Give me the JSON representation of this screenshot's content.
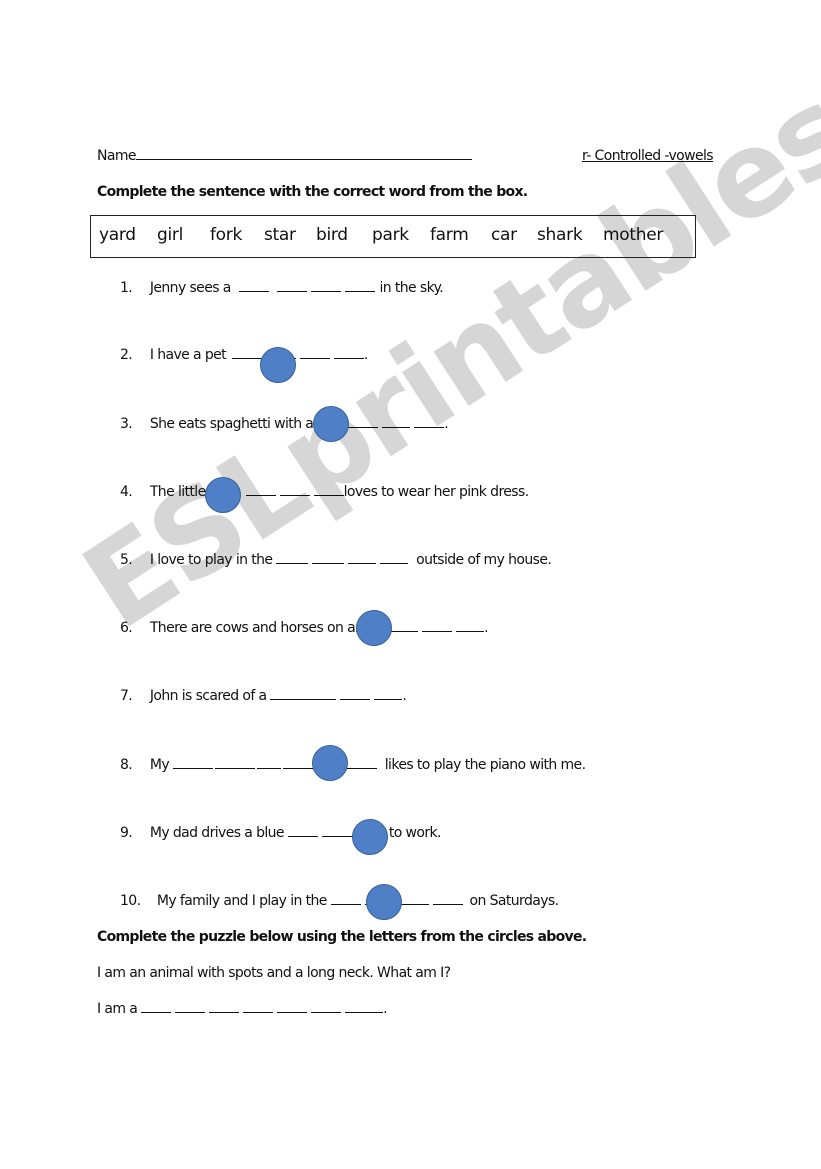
{
  "header": {
    "name_label": "Name",
    "topic": "r- Controlled -vowels"
  },
  "instructions": {
    "part1": "Complete the sentence with the correct word from the box.",
    "part2": "Complete the puzzle below using the letters from the circles above."
  },
  "word_bank": [
    "yard",
    "girl",
    "fork",
    "star",
    "bird",
    "park",
    "farm",
    "car",
    "shark",
    "mother"
  ],
  "sentences": [
    {
      "num": "1.",
      "before": "Jenny sees a",
      "after": "in the sky.",
      "has_circle": false
    },
    {
      "num": "2.",
      "before": "I have a pet",
      "after": ".",
      "has_circle": true
    },
    {
      "num": "3.",
      "before": "She eats spaghetti with a",
      "after": ".",
      "has_circle": true
    },
    {
      "num": "4.",
      "before": "The little",
      "after": "loves to wear her pink dress.",
      "has_circle": true
    },
    {
      "num": "5.",
      "before": "I love to play in the",
      "after": "outside of my house.",
      "has_circle": false
    },
    {
      "num": "6.",
      "before": "There are cows and horses on a",
      "after": ".",
      "has_circle": true
    },
    {
      "num": "7.",
      "before": "John is scared of a",
      "after": ".",
      "has_circle": false
    },
    {
      "num": "8.",
      "before": "My",
      "after": "likes to play the piano with me.",
      "has_circle": true
    },
    {
      "num": "9.",
      "before": "My dad drives a blue",
      "after": "to work.",
      "has_circle": true
    },
    {
      "num": "10.",
      "before": "My family and I play in the",
      "after": "on Saturdays.",
      "has_circle": true
    }
  ],
  "puzzle": {
    "riddle": "I am an animal with spots and a long neck.  What am I?",
    "answer_prefix": "I am a",
    "answer_suffix": "."
  },
  "watermark": "ESLprintables.com",
  "colors": {
    "circle_fill": "#4f7fc7",
    "circle_border": "#35609a",
    "watermark": "#cfcfcf"
  }
}
